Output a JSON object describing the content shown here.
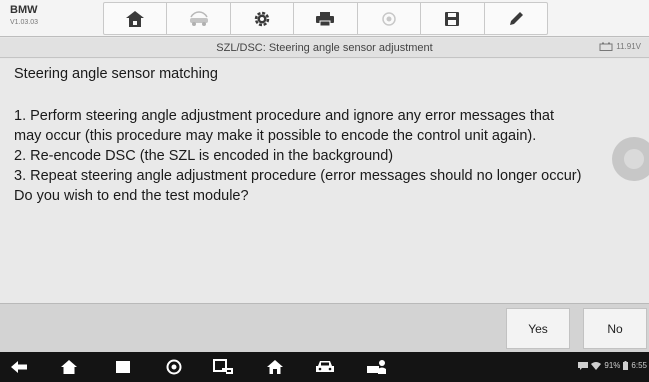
{
  "vehicle": {
    "make": "BMW",
    "version": "V1.03.03"
  },
  "toolbar": {
    "items": [
      {
        "icon": "home-icon"
      },
      {
        "icon": "vehicle-swap-icon"
      },
      {
        "icon": "settings-gear-icon"
      },
      {
        "icon": "print-icon"
      },
      {
        "icon": "help-icon"
      },
      {
        "icon": "save-icon"
      },
      {
        "icon": "edit-pen-icon"
      }
    ]
  },
  "header": {
    "title": "SZL/DSC: Steering angle sensor adjustment",
    "battery_voltage": "11.91V"
  },
  "message": {
    "title": "Steering angle sensor matching",
    "lines": [
      "1. Perform steering angle adjustment procedure and ignore any error messages that",
      "may occur (this procedure may make it possible to encode the control unit again).",
      "2. Re-encode DSC (the SZL is encoded in the background)",
      "3. Repeat steering angle adjustment procedure (error messages should no longer occur)",
      "Do you wish to end the test module?"
    ]
  },
  "actions": {
    "yes_label": "Yes",
    "no_label": "No"
  },
  "navbar": {
    "icons": [
      "back-icon",
      "home-icon",
      "recent-apps-icon",
      "browser-icon",
      "vci-connect-icon",
      "diagnostics-home-icon",
      "car-icon",
      "technician-icon"
    ]
  },
  "status": {
    "battery_percent": "91%",
    "time": "6:55"
  }
}
